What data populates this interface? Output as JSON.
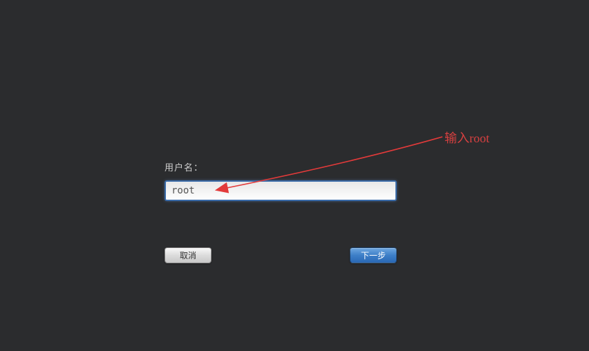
{
  "form": {
    "username_label": "用户名：",
    "username_value": "root"
  },
  "buttons": {
    "cancel": "取消",
    "next": "下一步"
  },
  "annotation": {
    "text": "输入root",
    "color": "#d84040"
  }
}
